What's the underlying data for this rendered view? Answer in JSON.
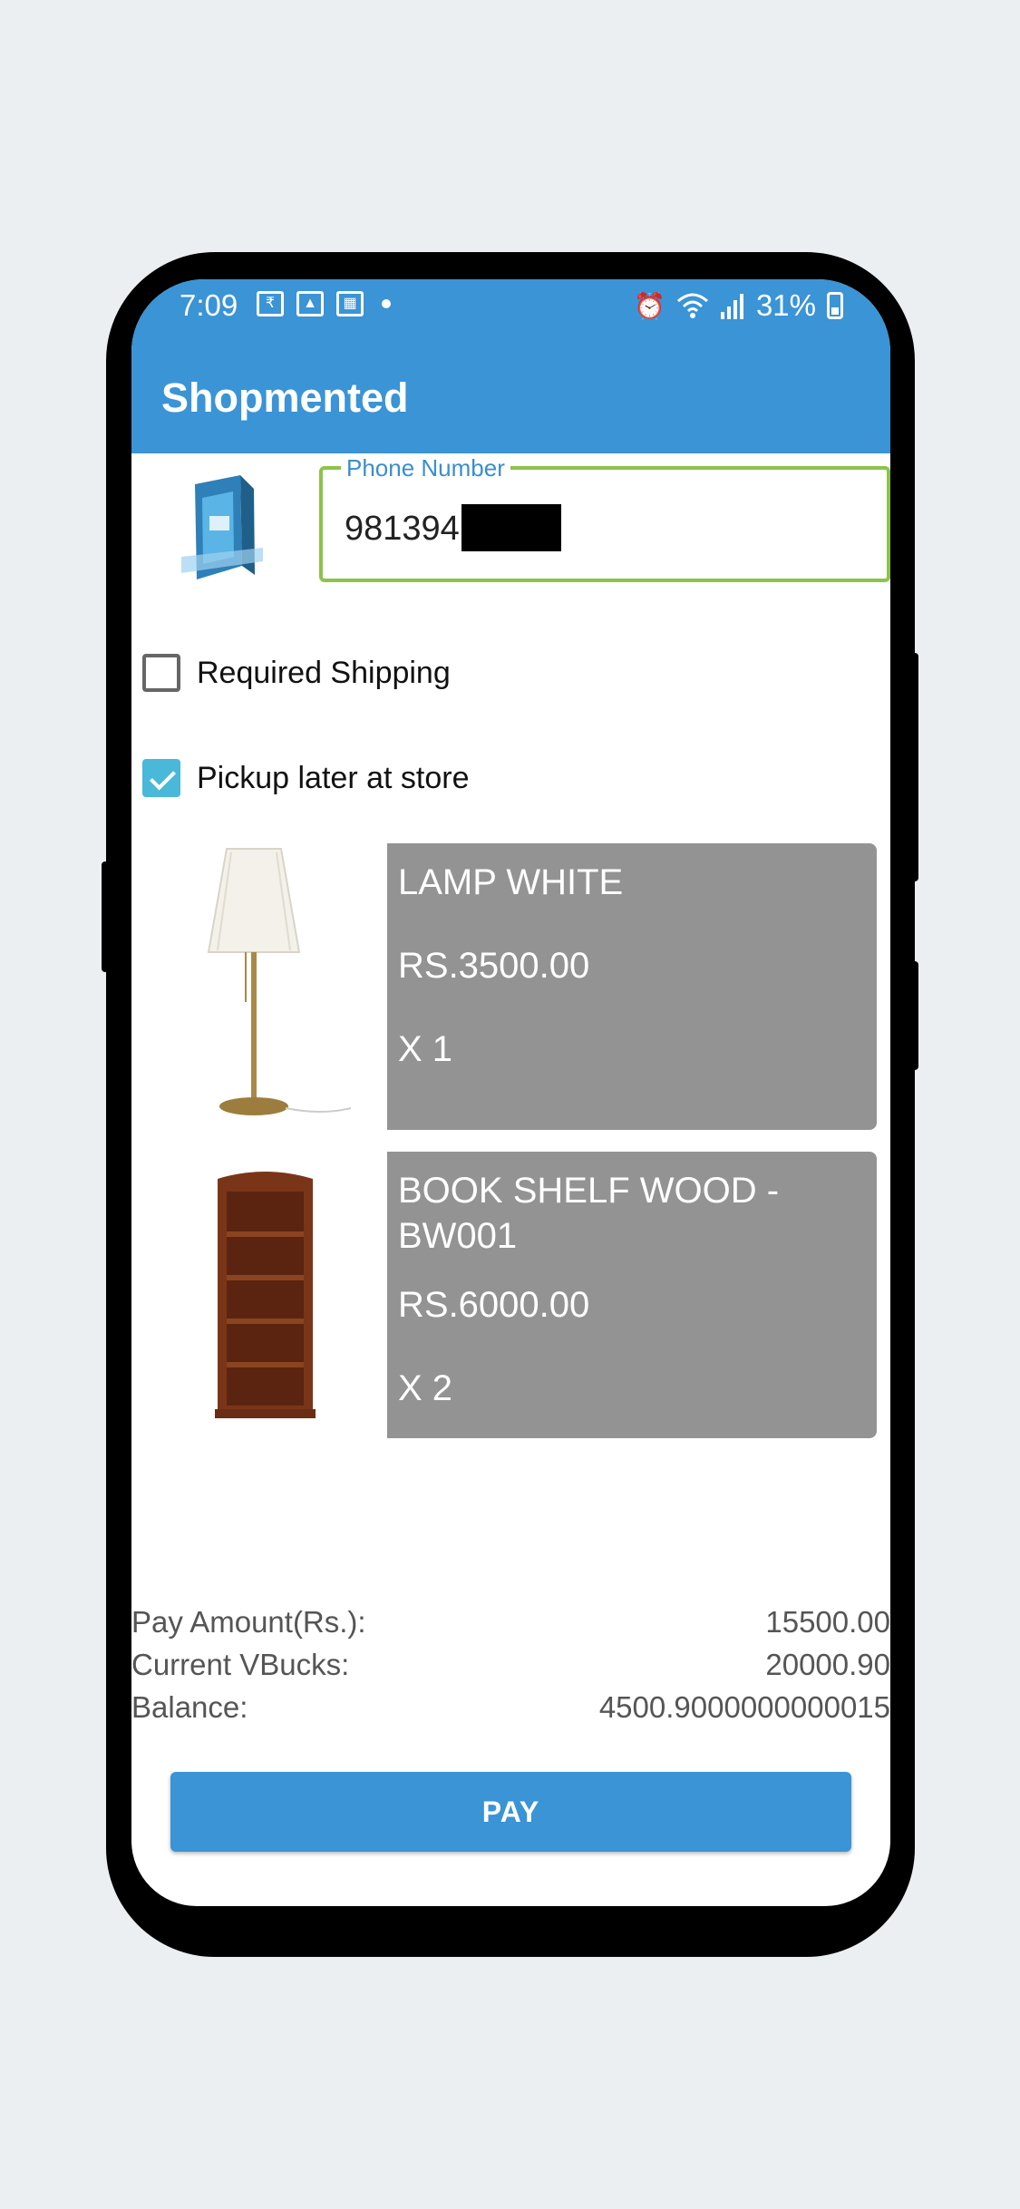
{
  "status_bar": {
    "time": "7:09",
    "battery": "31%",
    "left_icons": [
      "rupee-icon",
      "image-icon",
      "qr-icon",
      "dot-icon"
    ],
    "right_icons": [
      "alarm-icon",
      "wifi-icon",
      "signal-icon",
      "battery-icon"
    ]
  },
  "app_bar": {
    "title": "Shopmented"
  },
  "phone_field": {
    "label": "Phone Number",
    "value": "981394"
  },
  "options": {
    "required_shipping": {
      "label": "Required Shipping",
      "checked": false
    },
    "pickup_later": {
      "label": "Pickup later at store",
      "checked": true
    }
  },
  "products": [
    {
      "name": "LAMP WHITE",
      "price": "RS.3500.00",
      "qty": "X 1",
      "image": "lamp-image"
    },
    {
      "name": "BOOK SHELF WOOD - BW001",
      "price": "RS.6000.00",
      "qty": "X 2",
      "image": "bookshelf-image"
    }
  ],
  "summary": {
    "pay_amount_label": "Pay Amount(Rs.):",
    "pay_amount_value": "15500.00",
    "vbucks_label": "Current VBucks:",
    "vbucks_value": "20000.90",
    "balance_label": "Balance:",
    "balance_value": "4500.9000000000015"
  },
  "pay_button": {
    "label": "PAY"
  },
  "colors": {
    "primary": "#3a94d6",
    "field_border": "#8cc34a",
    "card_bg": "#939393",
    "checkbox_checked": "#4ab8d8",
    "page_bg": "#ebeff1"
  }
}
